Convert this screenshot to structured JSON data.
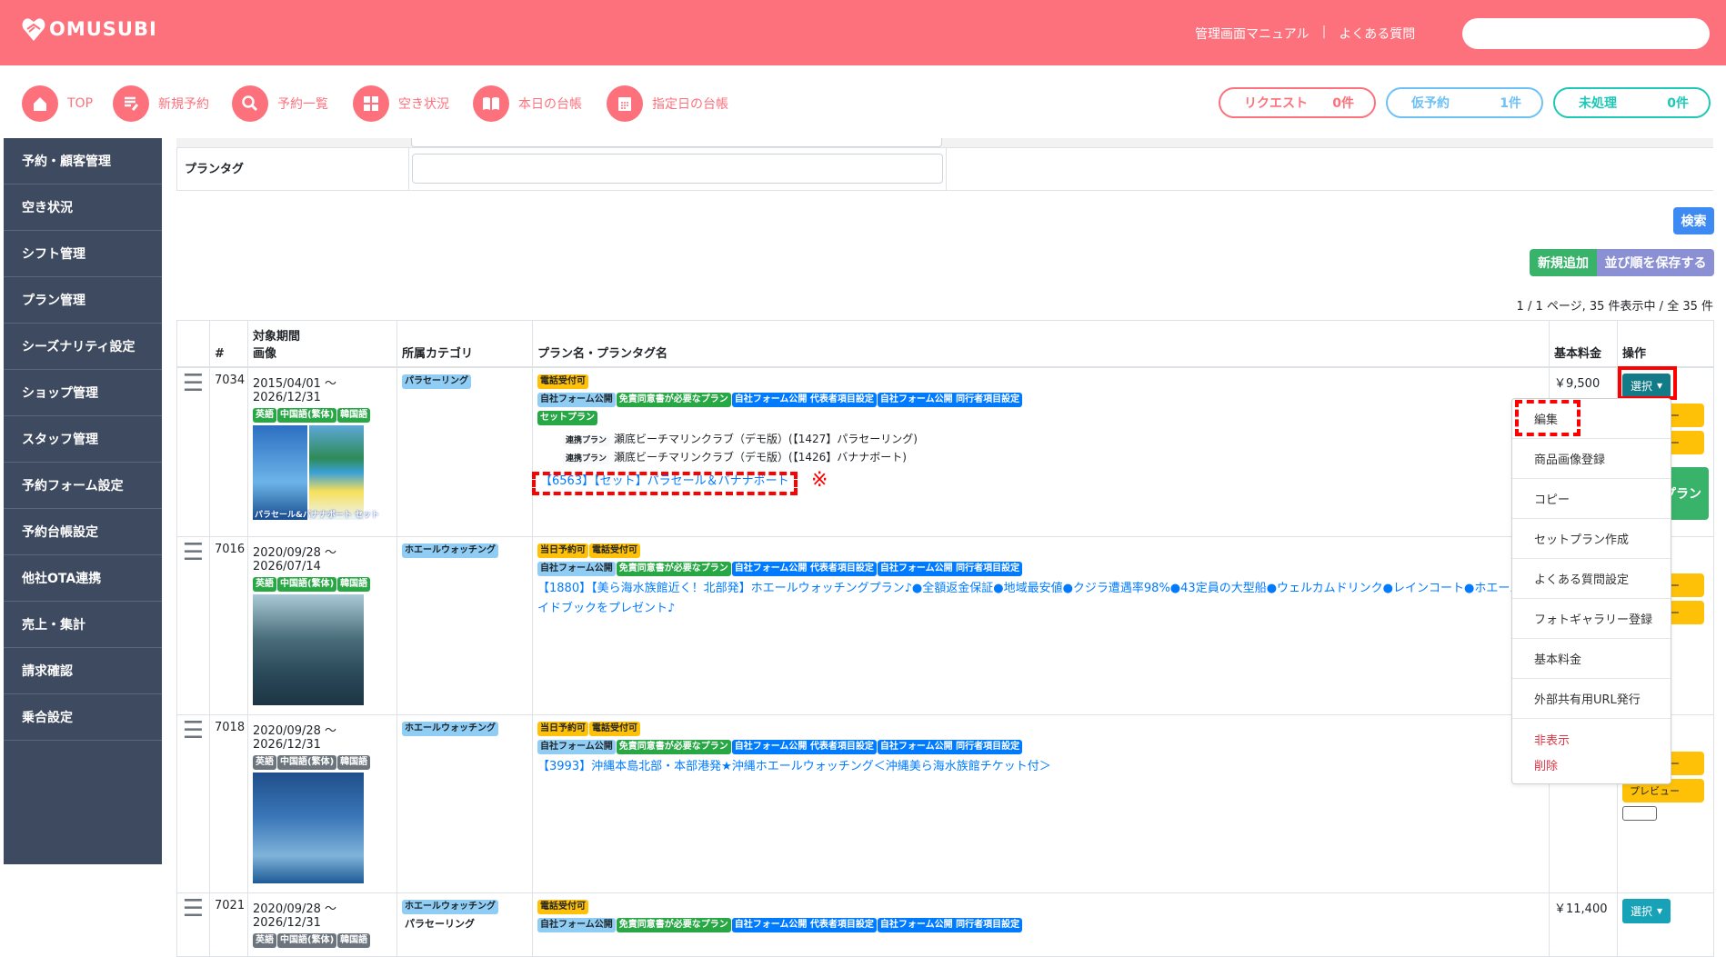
{
  "header": {
    "logo": "OMUSUBI",
    "links": [
      "管理画面マニュアル",
      "よくある質問"
    ],
    "search_value": ""
  },
  "nav": [
    {
      "label": "TOP",
      "icon": "home-icon"
    },
    {
      "label": "新規予約",
      "icon": "edit-icon"
    },
    {
      "label": "予約一覧",
      "icon": "search-icon"
    },
    {
      "label": "空き状況",
      "icon": "grid-icon"
    },
    {
      "label": "本日の台帳",
      "icon": "book-icon"
    },
    {
      "label": "指定日の台帳",
      "icon": "calendar-icon"
    }
  ],
  "status": [
    {
      "label": "リクエスト",
      "count": "0件",
      "color": "#fc717c"
    },
    {
      "label": "仮予約",
      "count": "1件",
      "color": "#6ec1f7"
    },
    {
      "label": "未処理",
      "count": "0件",
      "color": "#1fc7b6"
    }
  ],
  "sidebar": [
    "予約・顧客管理",
    "空き状況",
    "シフト管理",
    "プラン管理",
    "シーズナリティ設定",
    "ショップ管理",
    "スタッフ管理",
    "予約フォーム設定",
    "予約台帳設定",
    "他社OTA連携",
    "売上・集計",
    "請求確認",
    "乗合設定"
  ],
  "filter": {
    "plan_tag_label": "プランタグ",
    "plan_tag_value": ""
  },
  "buttons": {
    "search": "検索",
    "add": "新規追加",
    "save_order": "並び順を保存する"
  },
  "pagination": "1 / 1 ページ, 35 件表示中 / 全 35 件",
  "table": {
    "headers": [
      "",
      "#",
      "対象期間\n画像",
      "所属カテゴリ",
      "プラン名・プランタグ名",
      "基本料金",
      "操作"
    ],
    "select_label": "選択",
    "preview_label": "プレビュー",
    "set_plan_btn": "セットプラン",
    "rows": [
      {
        "id": "7034",
        "period": "2015/04/01 〜 2026/12/31",
        "langs": [
          "英語",
          "中国語(繁体)",
          "韓国語"
        ],
        "lang_color": "bg",
        "categories": [
          "パラセーリング"
        ],
        "image_caption": "パラセール&バナナボート セット",
        "tags": [
          [
            [
              "電話受付可",
              "by"
            ]
          ],
          [
            [
              "自社フォーム公開",
              "bl"
            ],
            [
              "免責同意書が必要なプラン",
              "bg"
            ],
            [
              "自社フォーム公開 代表者項目設定",
              "bb"
            ],
            [
              "自社フォーム公開 同行者項目設定",
              "bb"
            ]
          ],
          [
            [
              "セットプラン",
              "bg"
            ]
          ]
        ],
        "related": [
          {
            "tag": "連携プラン",
            "text": "瀬底ビーチマリンクラブ（デモ版）(【1427】パラセーリング)"
          },
          {
            "tag": "連携プラン",
            "text": "瀬底ビーチマリンクラブ（デモ版）(【1426】バナナボート)"
          }
        ],
        "name": "【6563】【セット】パラセール＆バナナボート",
        "price": "￥9,500"
      },
      {
        "id": "7016",
        "period": "2020/09/28 〜 2026/07/14",
        "langs": [
          "英語",
          "中国語(繁体)",
          "韓国語"
        ],
        "lang_color": "bg",
        "categories": [
          "ホエールウォッチング"
        ],
        "tags": [
          [
            [
              "当日予約可",
              "by"
            ],
            [
              "電話受付可",
              "by"
            ]
          ],
          [
            [
              "自社フォーム公開",
              "bl"
            ],
            [
              "免責同意書が必要なプラン",
              "bg"
            ],
            [
              "自社フォーム公開 代表者項目設定",
              "bb"
            ],
            [
              "自社フォーム公開 同行者項目設定",
              "bb"
            ]
          ]
        ],
        "related": [],
        "name": "【1880】【美ら海水族館近く！北部発】ホエールウォッチングプラン♪●全額返金保証●地域最安値●クジラ遭遇率98%●43定員の大型船●ウェルカムドリンク●レインコート●ホエールガイドブックをプレゼント♪",
        "price": ""
      },
      {
        "id": "7018",
        "period": "2020/09/28 〜 2026/12/31",
        "langs": [
          "英語",
          "中国語(繁体)",
          "韓国語"
        ],
        "lang_color": "bgr",
        "categories": [
          "ホエールウォッチング"
        ],
        "tags": [
          [
            [
              "当日予約可",
              "by"
            ],
            [
              "電話受付可",
              "by"
            ]
          ],
          [
            [
              "自社フォーム公開",
              "bl"
            ],
            [
              "免責同意書が必要なプラン",
              "bg"
            ],
            [
              "自社フォーム公開 代表者項目設定",
              "bb"
            ],
            [
              "自社フォーム公開 同行者項目設定",
              "bb"
            ]
          ]
        ],
        "related": [],
        "name": "【3993】沖縄本島北部・本部港発★沖縄ホエールウォッチング＜沖縄美ら海水族館チケット付＞",
        "price": ""
      },
      {
        "id": "7021",
        "period": "2020/09/28 〜 2026/12/31",
        "langs": [
          "英語",
          "中国語(繁体)",
          "韓国語"
        ],
        "lang_color": "bgr",
        "categories": [
          "ホエールウォッチング",
          "パラセーリング"
        ],
        "tags": [
          [
            [
              "電話受付可",
              "by"
            ]
          ],
          [
            [
              "自社フォーム公開",
              "bl"
            ],
            [
              "免責同意書が必要なプラン",
              "bg"
            ],
            [
              "自社フォーム公開 代表者項目設定",
              "bb"
            ],
            [
              "自社フォーム公開 同行者項目設定",
              "bb"
            ]
          ]
        ],
        "related": [],
        "name": "",
        "price": "￥11,400"
      }
    ]
  },
  "dropdown": {
    "items": [
      "編集",
      "商品画像登録",
      "コピー",
      "セットプラン作成",
      "よくある質問設定",
      "フォトギャラリー登録",
      "基本料金",
      "外部共有用URL発行"
    ],
    "danger": [
      "非表示",
      "削除"
    ]
  },
  "annotation_mark": "※"
}
